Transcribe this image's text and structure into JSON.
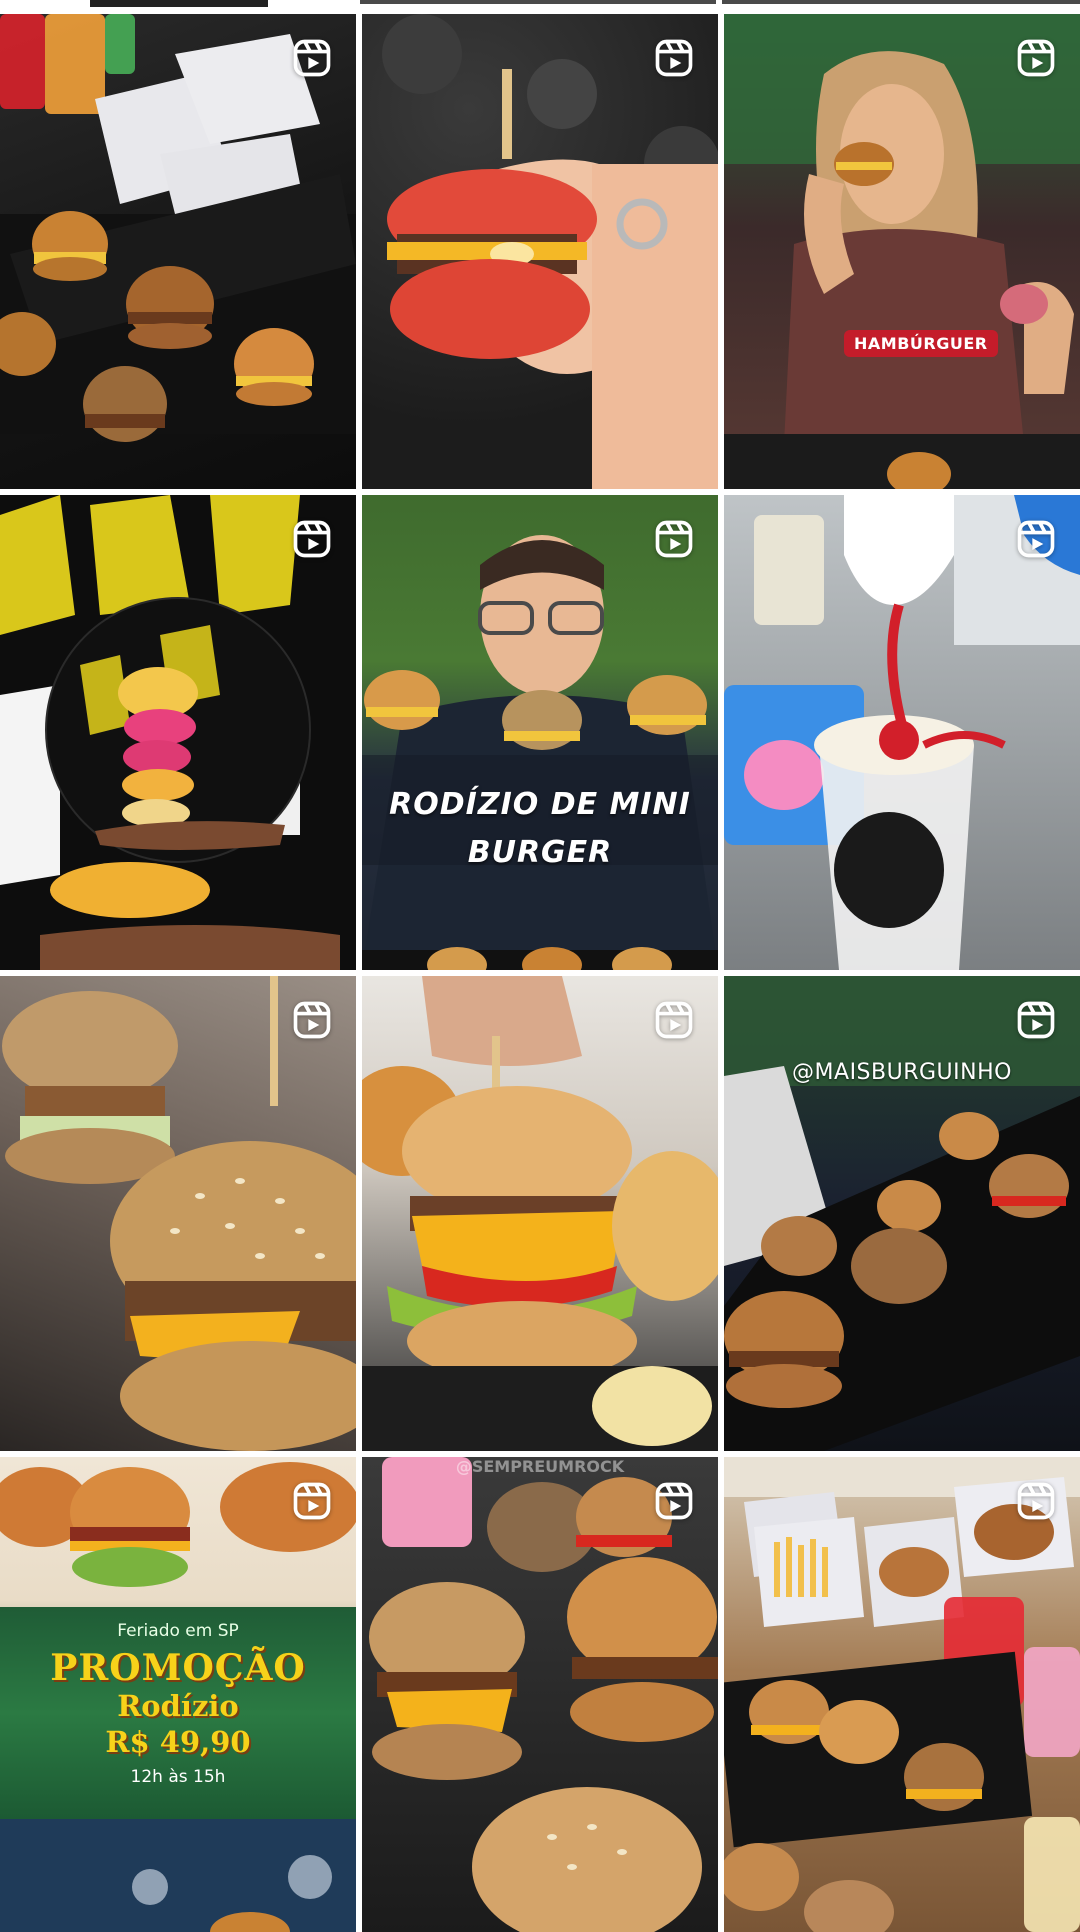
{
  "grid": {
    "posts": [
      {
        "id": "post-1",
        "type": "reel",
        "description_icon": "reels-icon"
      },
      {
        "id": "post-2",
        "type": "reel",
        "description_icon": "reels-icon"
      },
      {
        "id": "post-3",
        "type": "reel",
        "description_icon": "reels-icon",
        "badge": "HAMBÚRGUER"
      },
      {
        "id": "post-4",
        "type": "reel",
        "description_icon": "reels-icon"
      },
      {
        "id": "post-5",
        "type": "reel",
        "description_icon": "reels-icon",
        "caption_line1": "RODÍZIO DE MINI",
        "caption_line2": "BURGER"
      },
      {
        "id": "post-6",
        "type": "reel",
        "description_icon": "reels-icon"
      },
      {
        "id": "post-7",
        "type": "reel",
        "description_icon": "reels-icon"
      },
      {
        "id": "post-8",
        "type": "reel",
        "description_icon": "reels-icon"
      },
      {
        "id": "post-9",
        "type": "reel",
        "description_icon": "reels-icon",
        "handle": "@MAISBURGUINHO"
      },
      {
        "id": "post-10",
        "type": "reel",
        "description_icon": "reels-icon",
        "promo_small": "Feriado em SP",
        "promo_big": "PROMOÇÃO",
        "promo_mid": "Rodízio",
        "promo_price": "R$ 49,90",
        "promo_time": "12h às 15h"
      },
      {
        "id": "post-11",
        "type": "reel",
        "description_icon": "reels-icon",
        "watermark": "@SEMPREUMROCK"
      },
      {
        "id": "post-12",
        "type": "reel",
        "description_icon": "reels-icon"
      }
    ]
  },
  "colors": {
    "badge_red": "#c41c2a",
    "promo_yellow": "#f7d21a",
    "icon_white": "#ffffff"
  }
}
